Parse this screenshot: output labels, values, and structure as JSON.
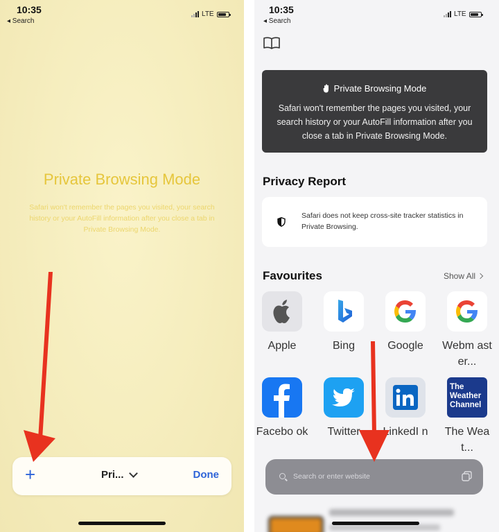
{
  "left_phone": {
    "status": {
      "time": "10:35",
      "back_label": "◂ Search",
      "network": "LTE"
    },
    "title": "Private Browsing Mode",
    "description": "Safari won't remember the pages you visited, your search history or your AutoFill information after you close a tab in Private Browsing Mode.",
    "bottom_bar": {
      "add_tab_label": "+",
      "tab_group_label": "Pri...",
      "done_label": "Done"
    }
  },
  "right_phone": {
    "status": {
      "time": "10:35",
      "back_label": "◂ Search",
      "network": "LTE"
    },
    "private_card": {
      "title": "Private Browsing Mode",
      "body": "Safari won't remember the pages you visited, your search history or your AutoFill information after you close a tab in Private Browsing Mode."
    },
    "privacy_report": {
      "heading": "Privacy Report",
      "text": "Safari does not keep cross-site tracker statistics in Private Browsing."
    },
    "favourites": {
      "heading": "Favourites",
      "show_all": "Show All",
      "items": [
        {
          "label": "Apple",
          "icon": "apple-icon"
        },
        {
          "label": "Bing",
          "icon": "bing-icon"
        },
        {
          "label": "Google",
          "icon": "google-icon"
        },
        {
          "label": "Webm aster...",
          "icon": "google-icon"
        },
        {
          "label": "Facebo ok",
          "icon": "facebook-icon"
        },
        {
          "label": "Twitter",
          "icon": "twitter-icon"
        },
        {
          "label": "LinkedI n",
          "icon": "linkedin-icon"
        },
        {
          "label": "The Weat...",
          "icon": "weather-channel-icon"
        }
      ],
      "weather_logo_text": "The Weather Channel"
    },
    "search_bar": {
      "placeholder": "Search or enter website"
    }
  },
  "colors": {
    "accent_blue": "#2d63d8",
    "annotation_arrow": "#e8321f",
    "private_title_yellow": "#e6c63c"
  }
}
